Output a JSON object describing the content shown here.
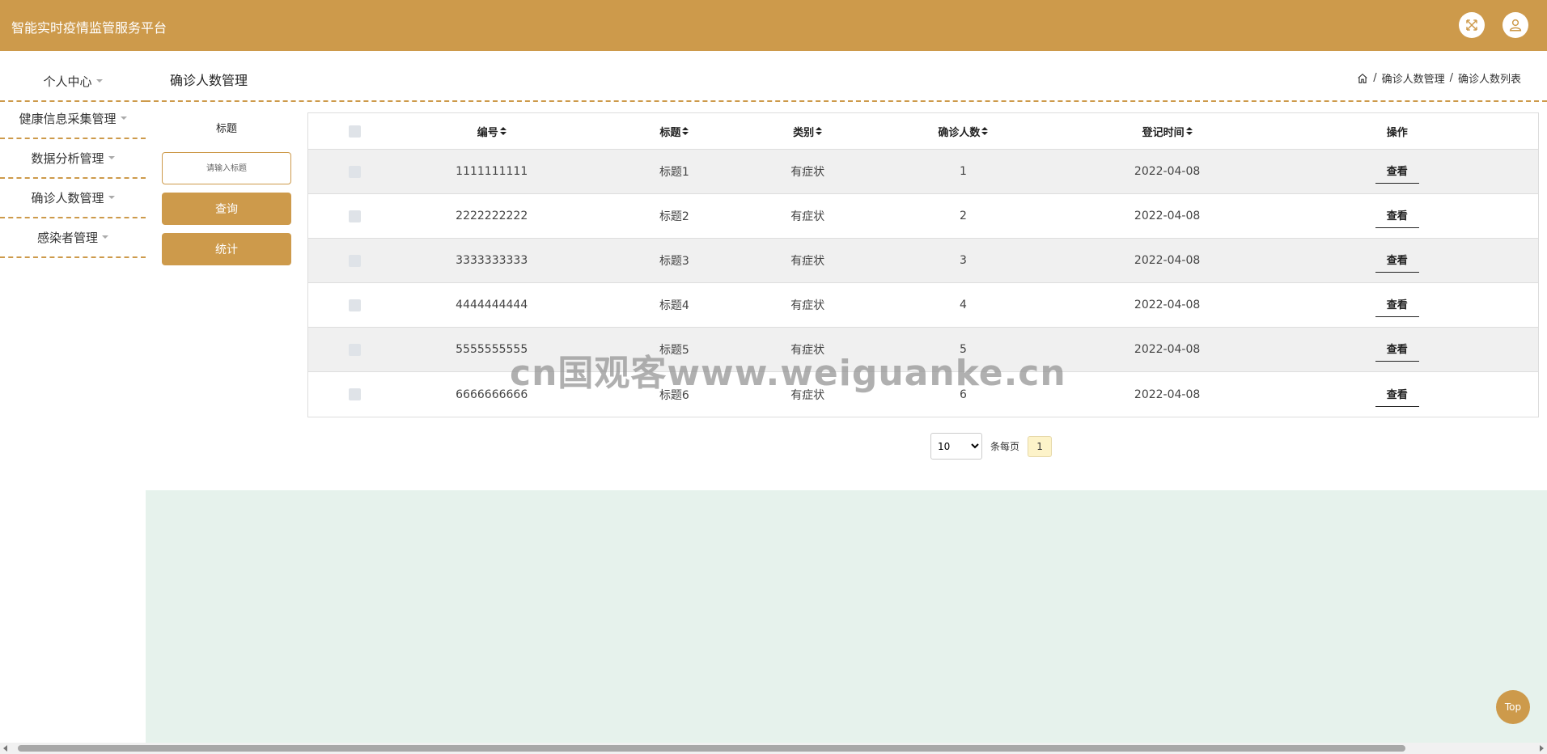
{
  "header": {
    "title": "智能实时疫情监管服务平台",
    "fullscreen_icon": "expand-icon",
    "user_icon": "user-icon"
  },
  "sidebar": {
    "items": [
      {
        "label": "个人中心"
      },
      {
        "label": "健康信息采集管理"
      },
      {
        "label": "数据分析管理"
      },
      {
        "label": "确诊人数管理"
      },
      {
        "label": "感染者管理"
      }
    ]
  },
  "page": {
    "title": "确诊人数管理",
    "breadcrumb": [
      "确诊人数管理",
      "确诊人数列表"
    ],
    "separator": "/"
  },
  "search": {
    "label": "标题",
    "placeholder": "请输入标题",
    "query_button": "查询",
    "stats_button": "统计"
  },
  "table": {
    "headers": {
      "no": "编号",
      "title": "标题",
      "type": "类别",
      "count": "确诊人数",
      "date": "登记时间",
      "op": "操作"
    },
    "rows": [
      {
        "no": "1111111111",
        "title": "标题1",
        "type": "有症状",
        "count": "1",
        "date": "2022-04-08",
        "op": "查看"
      },
      {
        "no": "2222222222",
        "title": "标题2",
        "type": "有症状",
        "count": "2",
        "date": "2022-04-08",
        "op": "查看"
      },
      {
        "no": "3333333333",
        "title": "标题3",
        "type": "有症状",
        "count": "3",
        "date": "2022-04-08",
        "op": "查看"
      },
      {
        "no": "4444444444",
        "title": "标题4",
        "type": "有症状",
        "count": "4",
        "date": "2022-04-08",
        "op": "查看"
      },
      {
        "no": "5555555555",
        "title": "标题5",
        "type": "有症状",
        "count": "5",
        "date": "2022-04-08",
        "op": "查看"
      },
      {
        "no": "6666666666",
        "title": "标题6",
        "type": "有症状",
        "count": "6",
        "date": "2022-04-08",
        "op": "查看"
      }
    ]
  },
  "pagination": {
    "page_size": "10",
    "per_page_label": "条每页",
    "current_page": "1"
  },
  "watermark": "cn国观客www.weiguanke.cn",
  "top_button": "Top",
  "colors": {
    "accent": "#cd9a4b",
    "bottom_area": "#e6f2ec",
    "row_alt": "#f0f0f0"
  }
}
